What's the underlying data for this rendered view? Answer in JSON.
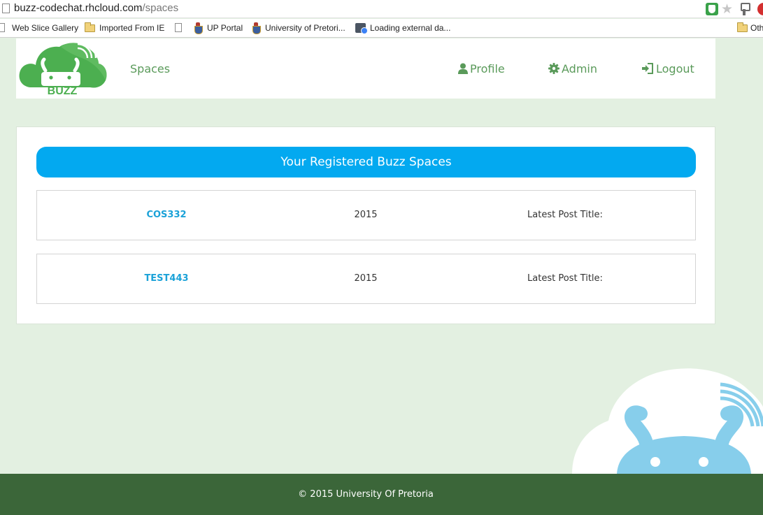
{
  "browser": {
    "url_host": "buzz-codechat.rhcloud.com",
    "url_path": "/spaces",
    "bookmarks": [
      {
        "label": "Web Slice Gallery",
        "icon": "page-icon"
      },
      {
        "label": "Imported From IE",
        "icon": "folder-icon"
      },
      {
        "label": "",
        "icon": "page-icon"
      },
      {
        "label": "UP Portal",
        "icon": "crest-icon"
      },
      {
        "label": "University of Pretori...",
        "icon": "crest-icon"
      },
      {
        "label": "Loading external da...",
        "icon": "loading-icon"
      },
      {
        "label": "Oth",
        "icon": "folder-icon"
      }
    ]
  },
  "header": {
    "logo_text": "BUZZ",
    "nav": {
      "spaces": "Spaces",
      "profile": "Profile",
      "admin": "Admin",
      "logout": "Logout"
    }
  },
  "main": {
    "title": "Your Registered Buzz Spaces",
    "spaces": [
      {
        "name": "COS332",
        "year": "2015",
        "post_label": "Latest Post Title:"
      },
      {
        "name": "TEST443",
        "year": "2015",
        "post_label": "Latest Post Title:"
      }
    ]
  },
  "footer": {
    "copyright": "© 2015 University Of Pretoria"
  },
  "colors": {
    "page_background": "#e3f0e1",
    "brand_green": "#5a9a5a",
    "accent_blue": "#03a9f0",
    "link_blue": "#1ba2d8",
    "footer_green": "#3b6639"
  }
}
